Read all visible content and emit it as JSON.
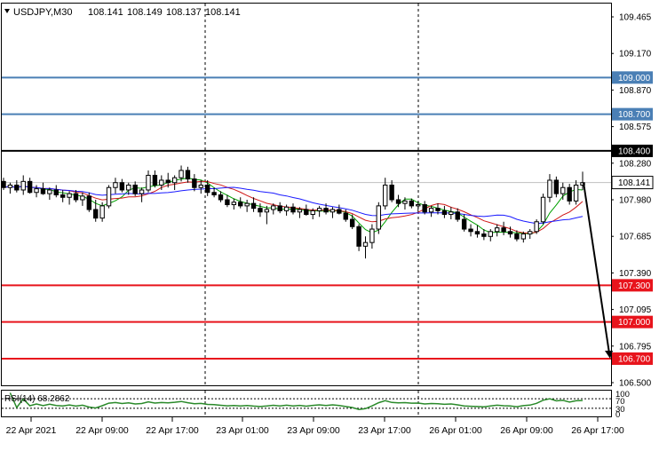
{
  "chart_data": {
    "type": "candlestick",
    "header": {
      "symbol_timeframe": "USDJPY,M30",
      "ohlc": [
        "108.141",
        "108.149",
        "108.137",
        "108.141"
      ]
    },
    "price_axis": {
      "ylim": [
        106.5,
        109.5
      ],
      "ticks": [
        "109.465",
        "109.170",
        "108.870",
        "108.575",
        "108.280",
        "107.980",
        "107.685",
        "107.390",
        "107.095",
        "106.795",
        "106.500"
      ]
    },
    "time_axis": {
      "labels": [
        "22 Apr 2021",
        "22 Apr 09:00",
        "22 Apr 17:00",
        "23 Apr 01:00",
        "23 Apr 09:00",
        "23 Apr 17:00",
        "26 Apr 01:00",
        "26 Apr 09:00",
        "26 Apr 17:00"
      ],
      "session_separators": [
        "23 Apr 01:00",
        "23 Apr 17:00"
      ]
    },
    "levels": [
      {
        "value": 109.0,
        "label": "109.000",
        "color": "#4a7fb5"
      },
      {
        "value": 108.7,
        "label": "108.700",
        "color": "#4a7fb5"
      },
      {
        "value": 108.4,
        "label": "108.400",
        "color": "#000000"
      },
      {
        "value": 107.3,
        "label": "107.300",
        "color": "#e8141c"
      },
      {
        "value": 107.0,
        "label": "107.000",
        "color": "#e8141c"
      },
      {
        "value": 106.7,
        "label": "106.700",
        "color": "#e8141c"
      }
    ],
    "current_price": {
      "value": 108.141,
      "label": "108.141",
      "line_color": "#c0c0c0"
    },
    "forecast_arrow": {
      "from": 108.141,
      "to": 106.7,
      "color": "#000000"
    },
    "moving_averages": [
      {
        "color": "#00a000"
      },
      {
        "color": "#d01818"
      },
      {
        "color": "#1a1aff"
      }
    ],
    "candles": [
      [
        108.15,
        108.18,
        108.08,
        108.1
      ],
      [
        108.1,
        108.14,
        108.05,
        108.12
      ],
      [
        108.12,
        108.16,
        108.06,
        108.08
      ],
      [
        108.08,
        108.2,
        108.04,
        108.15
      ],
      [
        108.15,
        108.18,
        108.05,
        108.06
      ],
      [
        108.06,
        108.12,
        108.02,
        108.09
      ],
      [
        108.09,
        108.14,
        108.04,
        108.05
      ],
      [
        108.05,
        108.1,
        108.0,
        108.08
      ],
      [
        108.08,
        108.12,
        108.02,
        108.04
      ],
      [
        108.04,
        108.08,
        107.98,
        108.02
      ],
      [
        108.02,
        108.07,
        107.96,
        108.05
      ],
      [
        108.05,
        108.08,
        107.98,
        108.0
      ],
      [
        108.0,
        108.06,
        107.95,
        108.03
      ],
      [
        108.03,
        108.06,
        107.9,
        107.92
      ],
      [
        107.92,
        108.0,
        107.82,
        107.85
      ],
      [
        107.85,
        107.98,
        107.82,
        107.95
      ],
      [
        107.95,
        108.12,
        107.93,
        108.1
      ],
      [
        108.1,
        108.18,
        108.05,
        108.14
      ],
      [
        108.14,
        108.17,
        108.06,
        108.08
      ],
      [
        108.08,
        108.14,
        108.04,
        108.12
      ],
      [
        108.12,
        108.15,
        108.03,
        108.05
      ],
      [
        108.05,
        108.1,
        107.98,
        108.08
      ],
      [
        108.08,
        108.24,
        108.06,
        108.2
      ],
      [
        108.2,
        108.24,
        108.1,
        108.12
      ],
      [
        108.12,
        108.2,
        108.08,
        108.16
      ],
      [
        108.16,
        108.22,
        108.1,
        108.14
      ],
      [
        108.14,
        108.2,
        108.08,
        108.18
      ],
      [
        108.18,
        108.28,
        108.15,
        108.24
      ],
      [
        108.24,
        108.27,
        108.14,
        108.17
      ],
      [
        108.17,
        108.21,
        108.07,
        108.1
      ],
      [
        108.1,
        108.16,
        108.05,
        108.12
      ],
      [
        108.12,
        108.16,
        108.03,
        108.06
      ],
      [
        108.06,
        108.1,
        108.02,
        108.04
      ],
      [
        108.04,
        108.07,
        107.98,
        108.0
      ],
      [
        108.0,
        108.04,
        107.94,
        107.96
      ],
      [
        107.96,
        108.01,
        107.92,
        107.98
      ],
      [
        107.98,
        108.02,
        107.93,
        107.95
      ],
      [
        107.95,
        108.0,
        107.9,
        107.97
      ],
      [
        107.97,
        108.02,
        107.9,
        107.93
      ],
      [
        107.93,
        107.97,
        107.86,
        107.9
      ],
      [
        107.9,
        107.95,
        107.8,
        107.92
      ],
      [
        107.92,
        107.97,
        107.88,
        107.95
      ],
      [
        107.95,
        107.98,
        107.89,
        107.91
      ],
      [
        107.91,
        107.96,
        107.87,
        107.94
      ],
      [
        107.94,
        107.97,
        107.88,
        107.9
      ],
      [
        107.9,
        107.94,
        107.85,
        107.92
      ],
      [
        107.92,
        107.96,
        107.87,
        107.88
      ],
      [
        107.88,
        107.93,
        107.84,
        107.91
      ],
      [
        107.91,
        107.95,
        107.86,
        107.93
      ],
      [
        107.93,
        107.97,
        107.88,
        107.9
      ],
      [
        107.9,
        107.94,
        107.85,
        107.92
      ],
      [
        107.92,
        107.96,
        107.88,
        107.89
      ],
      [
        107.89,
        107.92,
        107.82,
        107.84
      ],
      [
        107.84,
        107.88,
        107.76,
        107.78
      ],
      [
        107.78,
        107.8,
        107.58,
        107.62
      ],
      [
        107.62,
        107.7,
        107.52,
        107.65
      ],
      [
        107.65,
        107.8,
        107.6,
        107.76
      ],
      [
        107.76,
        107.98,
        107.72,
        107.95
      ],
      [
        107.95,
        108.18,
        107.92,
        108.12
      ],
      [
        108.12,
        108.16,
        107.98,
        108.0
      ],
      [
        108.0,
        108.04,
        107.94,
        107.97
      ],
      [
        107.97,
        108.02,
        107.92,
        107.99
      ],
      [
        107.99,
        108.01,
        107.93,
        107.95
      ],
      [
        107.95,
        107.99,
        107.9,
        107.96
      ],
      [
        107.96,
        107.99,
        107.88,
        107.9
      ],
      [
        107.9,
        107.95,
        107.86,
        107.93
      ],
      [
        107.93,
        107.97,
        107.88,
        107.91
      ],
      [
        107.91,
        107.95,
        107.85,
        107.88
      ],
      [
        107.88,
        107.94,
        107.84,
        107.9
      ],
      [
        107.9,
        107.93,
        107.82,
        107.84
      ],
      [
        107.84,
        107.88,
        107.74,
        107.76
      ],
      [
        107.76,
        107.8,
        107.7,
        107.74
      ],
      [
        107.74,
        107.79,
        107.69,
        107.72
      ],
      [
        107.72,
        107.76,
        107.67,
        107.7
      ],
      [
        107.7,
        107.76,
        107.66,
        107.74
      ],
      [
        107.74,
        107.8,
        107.7,
        107.77
      ],
      [
        107.77,
        107.82,
        107.71,
        107.74
      ],
      [
        107.74,
        107.78,
        107.69,
        107.72
      ],
      [
        107.72,
        107.75,
        107.66,
        107.68
      ],
      [
        107.68,
        107.74,
        107.65,
        107.72
      ],
      [
        107.72,
        107.76,
        107.68,
        107.74
      ],
      [
        107.74,
        107.84,
        107.72,
        107.82
      ],
      [
        107.82,
        108.05,
        107.8,
        108.02
      ],
      [
        108.02,
        108.21,
        107.98,
        108.16
      ],
      [
        108.16,
        108.19,
        108.02,
        108.05
      ],
      [
        108.05,
        108.14,
        108.0,
        108.1
      ],
      [
        108.1,
        108.13,
        107.96,
        107.99
      ],
      [
        107.99,
        108.16,
        107.96,
        108.12
      ],
      [
        108.12,
        108.23,
        108.08,
        108.14
      ]
    ],
    "rsi": {
      "label": "RSI(14) 68.2862",
      "ticks": [
        "100",
        "70",
        "30",
        "0"
      ],
      "levels": [
        70,
        30
      ],
      "line_color": "#2a8a2a"
    }
  }
}
